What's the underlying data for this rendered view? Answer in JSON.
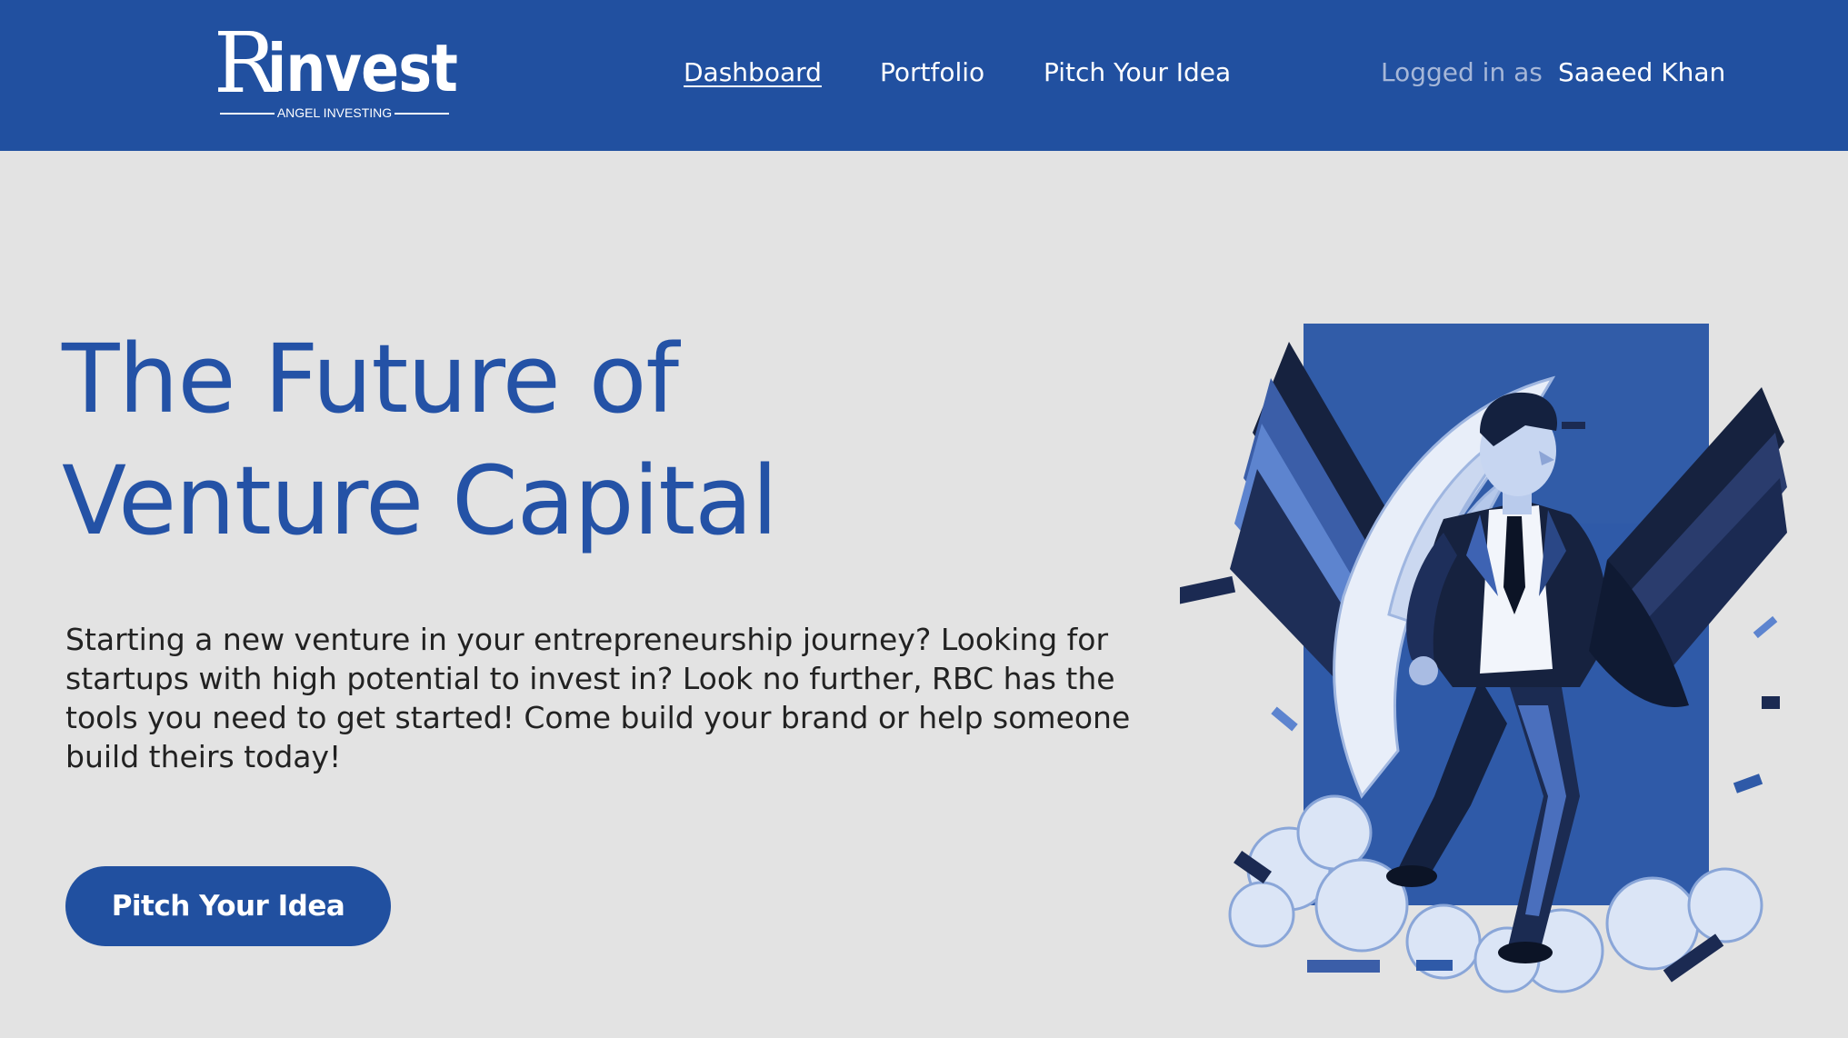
{
  "brand": {
    "logo_r": "R",
    "logo_rest": "invest",
    "tagline": "ANGEL INVESTING",
    "primary_color": "#2150a0",
    "headline_color": "#2452a6",
    "background_color": "#e3e3e3"
  },
  "nav": {
    "links": [
      {
        "label": "Dashboard",
        "active": true
      },
      {
        "label": "Portfolio",
        "active": false
      },
      {
        "label": "Pitch Your Idea",
        "active": false
      }
    ],
    "logged_in_label": "Logged in as",
    "user_name": "Saaeed Khan"
  },
  "hero": {
    "headline_line1": "The Future of",
    "headline_line2": "Venture Capital",
    "body": "Starting a new venture in your entrepreneurship journey? Looking for startups with high potential to invest in? Look no further, RBC has the tools you need to get started! Come build your brand or help someone build theirs today!",
    "cta_label": "Pitch Your Idea",
    "illustration_icon": "winged-businessman-illustration"
  }
}
